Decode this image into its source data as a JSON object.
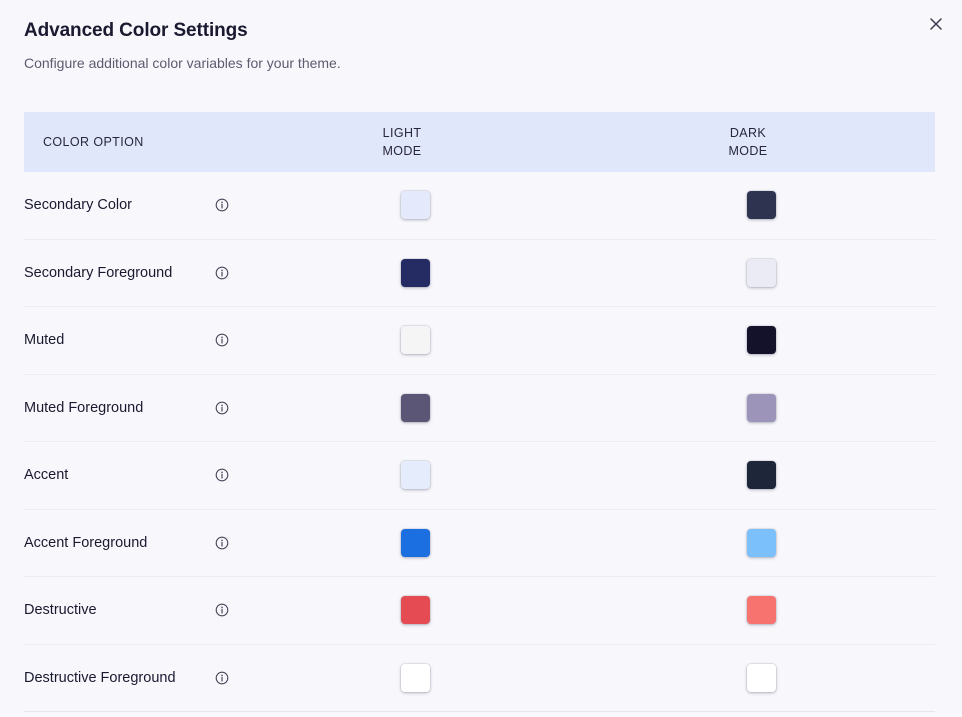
{
  "dialog": {
    "title": "Advanced Color Settings",
    "subtitle": "Configure additional color variables for your theme.",
    "close_icon": "close-icon"
  },
  "table": {
    "headers": {
      "option": "COLOR OPTION",
      "light": "LIGHT\nMODE",
      "dark": "DARK\nMODE"
    },
    "rows": [
      {
        "label": "Secondary Color",
        "light": "#e4e9fb",
        "dark": "#2e3350"
      },
      {
        "label": "Secondary Foreground",
        "light": "#252b63",
        "dark": "#ebebf5"
      },
      {
        "label": "Muted",
        "light": "#f5f5f5",
        "dark": "#14122a"
      },
      {
        "label": "Muted Foreground",
        "light": "#5b5676",
        "dark": "#9c95b9"
      },
      {
        "label": "Accent",
        "light": "#e5ecfb",
        "dark": "#1d2739"
      },
      {
        "label": "Accent Foreground",
        "light": "#1c6fe0",
        "dark": "#7cc0fb"
      },
      {
        "label": "Destructive",
        "light": "#e54b52",
        "dark": "#f6736f"
      },
      {
        "label": "Destructive Foreground",
        "light": "#ffffff",
        "dark": "#ffffff"
      }
    ]
  }
}
